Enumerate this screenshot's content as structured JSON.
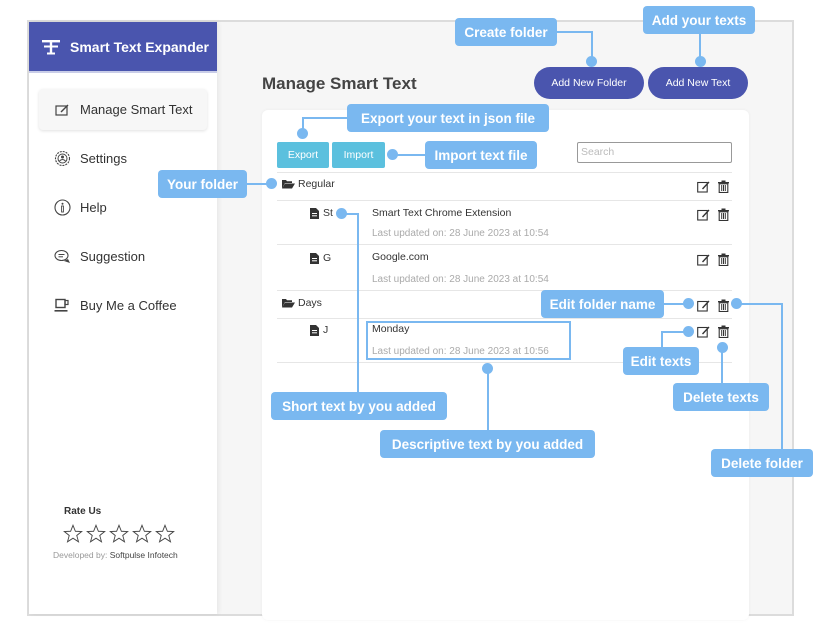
{
  "app": {
    "title": "Smart Text Expander"
  },
  "sidebar": {
    "items": [
      {
        "label": "Manage Smart Text",
        "icon": "edit-note-icon",
        "active": true
      },
      {
        "label": "Settings",
        "icon": "gear-icon",
        "active": false
      },
      {
        "label": "Help",
        "icon": "info-icon",
        "active": false
      },
      {
        "label": "Suggestion",
        "icon": "chat-icon",
        "active": false
      },
      {
        "label": "Buy Me a Coffee",
        "icon": "coffee-cup-icon",
        "active": false
      }
    ],
    "rate": {
      "title": "Rate Us",
      "stars_total": 5,
      "stars_filled": 0,
      "developed_by_label": "Developed by:",
      "developer": "Softpulse Infotech"
    }
  },
  "main": {
    "title": "Manage Smart Text",
    "add_folder_label": "Add New Folder",
    "add_text_label": "Add New Text",
    "export_label": "Export",
    "import_label": "Import",
    "search_placeholder": "Search",
    "folders": [
      {
        "name": "Regular",
        "texts": [
          {
            "short": "St",
            "description": "Smart Text Chrome Extension",
            "updated": "Last updated on: 28 June 2023 at 10:54"
          },
          {
            "short": "G",
            "description": "Google.com",
            "updated": "Last updated on: 28 June 2023 at 10:54"
          }
        ]
      },
      {
        "name": "Days",
        "texts": [
          {
            "short": "J",
            "description": "Monday",
            "updated": "Last updated on: 28 June 2023 at 10:56"
          }
        ]
      }
    ]
  },
  "annotations": {
    "create_folder": "Create folder",
    "add_texts": "Add your texts",
    "export_json": "Export your text in json file",
    "import_file": "Import text file",
    "your_folder": "Your folder",
    "edit_folder_name": "Edit folder name",
    "edit_texts": "Edit texts",
    "delete_texts": "Delete texts",
    "delete_folder": "Delete folder",
    "short_text": "Short text by you added",
    "descriptive_text": "Descriptive text by you added"
  },
  "colors": {
    "brand": "#4a55ae",
    "info_button": "#5bc0de",
    "callout": "#7ab8f0"
  }
}
